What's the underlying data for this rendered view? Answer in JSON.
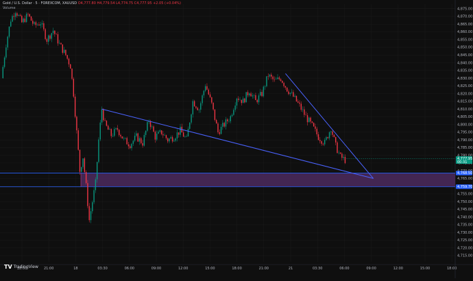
{
  "header": {
    "symbol_line": "Gold / U.S. Dollar · 5 · FOREXCOM, XAUUSD",
    "ohlc": "O4,777.80 H4,779.54 L4,774.75 C4,777.95 +2.05 (+0.04%)",
    "volume_label": "Volume"
  },
  "logo": {
    "text": "TradingView"
  },
  "chart_data": {
    "type": "candlestick",
    "title": "",
    "xlabel": "",
    "ylabel": "",
    "x_tick_labels": [
      "18:00",
      "21:00",
      "18",
      "03:30",
      "06:00",
      "09:00",
      "12:00",
      "15:00",
      "18:00",
      "21:00",
      "21",
      "03:30",
      "06:00",
      "09:00",
      "12:00",
      "15:00",
      "18:00",
      "21:00"
    ],
    "y_tick_labels": [
      "4,875.00",
      "4,870.00",
      "4,865.00",
      "4,860.00",
      "4,855.00",
      "4,850.00",
      "4,845.00",
      "4,840.00",
      "4,835.00",
      "4,830.00",
      "4,825.00",
      "4,820.00",
      "4,815.00",
      "4,810.00",
      "4,805.00",
      "4,800.00",
      "4,795.00",
      "4,790.00",
      "4,785.00",
      "4,780.00",
      "4,775.00",
      "4,770.00",
      "4,765.00",
      "4,760.00",
      "4,755.00",
      "4,750.00",
      "4,745.00",
      "4,740.00",
      "4,735.00",
      "4,730.00",
      "4,725.00",
      "4,720.00",
      "4,715.00"
    ],
    "ylim": [
      4711,
      4878
    ],
    "price_path": [
      {
        "t": 0,
        "p": 4830
      },
      {
        "t": 3,
        "p": 4852
      },
      {
        "t": 6,
        "p": 4868
      },
      {
        "t": 9,
        "p": 4874
      },
      {
        "t": 13,
        "p": 4866
      },
      {
        "t": 17,
        "p": 4871
      },
      {
        "t": 21,
        "p": 4864
      },
      {
        "t": 25,
        "p": 4866
      },
      {
        "t": 29,
        "p": 4855
      },
      {
        "t": 33,
        "p": 4861
      },
      {
        "t": 37,
        "p": 4852
      },
      {
        "t": 41,
        "p": 4845
      },
      {
        "t": 44,
        "p": 4838
      },
      {
        "t": 46,
        "p": 4820
      },
      {
        "t": 48,
        "p": 4795
      },
      {
        "t": 50,
        "p": 4770
      },
      {
        "t": 52,
        "p": 4779
      },
      {
        "t": 54,
        "p": 4760
      },
      {
        "t": 56,
        "p": 4738
      },
      {
        "t": 58,
        "p": 4750
      },
      {
        "t": 60,
        "p": 4762
      },
      {
        "t": 62,
        "p": 4790
      },
      {
        "t": 64,
        "p": 4810
      },
      {
        "t": 66,
        "p": 4800
      },
      {
        "t": 70,
        "p": 4793
      },
      {
        "t": 74,
        "p": 4797
      },
      {
        "t": 78,
        "p": 4790
      },
      {
        "t": 82,
        "p": 4787
      },
      {
        "t": 86,
        "p": 4792
      },
      {
        "t": 90,
        "p": 4788
      },
      {
        "t": 94,
        "p": 4803
      },
      {
        "t": 98,
        "p": 4792
      },
      {
        "t": 102,
        "p": 4795
      },
      {
        "t": 106,
        "p": 4790
      },
      {
        "t": 110,
        "p": 4792
      },
      {
        "t": 114,
        "p": 4796
      },
      {
        "t": 118,
        "p": 4790
      },
      {
        "t": 122,
        "p": 4815
      },
      {
        "t": 126,
        "p": 4810
      },
      {
        "t": 130,
        "p": 4826
      },
      {
        "t": 134,
        "p": 4813
      },
      {
        "t": 138,
        "p": 4795
      },
      {
        "t": 142,
        "p": 4800
      },
      {
        "t": 146,
        "p": 4805
      },
      {
        "t": 150,
        "p": 4818
      },
      {
        "t": 154,
        "p": 4815
      },
      {
        "t": 158,
        "p": 4822
      },
      {
        "t": 162,
        "p": 4815
      },
      {
        "t": 166,
        "p": 4820
      },
      {
        "t": 170,
        "p": 4832
      },
      {
        "t": 174,
        "p": 4828
      },
      {
        "t": 178,
        "p": 4830
      },
      {
        "t": 182,
        "p": 4823
      },
      {
        "t": 186,
        "p": 4818
      },
      {
        "t": 190,
        "p": 4812
      },
      {
        "t": 194,
        "p": 4805
      },
      {
        "t": 198,
        "p": 4799
      },
      {
        "t": 202,
        "p": 4792
      },
      {
        "t": 206,
        "p": 4788
      },
      {
        "t": 210,
        "p": 4798
      },
      {
        "t": 213,
        "p": 4786
      },
      {
        "t": 216,
        "p": 4779
      },
      {
        "t": 219,
        "p": 4777
      }
    ],
    "zone": {
      "top": 4768.5,
      "bottom": 4759.7,
      "color": "#4c2a5e"
    },
    "trendlines": [
      {
        "from": {
          "t": 64,
          "p": 4810
        },
        "to": {
          "t": 237,
          "p": 4765
        },
        "color": "#4a63ff"
      },
      {
        "from": {
          "t": 181,
          "p": 4833
        },
        "to": {
          "t": 237,
          "p": 4765
        },
        "color": "#4a63ff"
      }
    ],
    "price_tags": [
      {
        "label": "4,777.95",
        "sub": "00:31",
        "price": 4777.95,
        "color": "#089981"
      },
      {
        "label": "4,768.50",
        "price": 4768.5,
        "color": "#2962ff"
      },
      {
        "label": "4,759.70",
        "price": 4759.7,
        "color": "#2962ff"
      }
    ],
    "colors": {
      "up": "#089981",
      "down": "#f23645",
      "background": "#0f0f0f",
      "grid": "#1c1c1c",
      "axis": "#2a2e39"
    },
    "grid": true
  }
}
